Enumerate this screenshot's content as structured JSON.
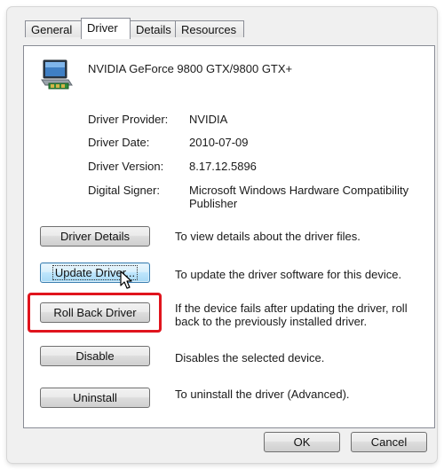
{
  "tabs": [
    {
      "label": "General"
    },
    {
      "label": "Driver"
    },
    {
      "label": "Details"
    },
    {
      "label": "Resources"
    }
  ],
  "device": {
    "name": "NVIDIA GeForce 9800 GTX/9800 GTX+",
    "icon": "display-adapter-icon"
  },
  "info": {
    "provider_label": "Driver Provider:",
    "provider_value": "NVIDIA",
    "date_label": "Driver Date:",
    "date_value": "2010-07-09",
    "version_label": "Driver Version:",
    "version_value": "8.17.12.5896",
    "signer_label": "Digital Signer:",
    "signer_value": "Microsoft Windows Hardware Compatibility Publisher"
  },
  "actions": {
    "driver_details": {
      "label": "Driver Details",
      "description": "To view details about the driver files."
    },
    "update_driver": {
      "label": "Update Driver...",
      "description": "To update the driver software for this device."
    },
    "roll_back": {
      "label": "Roll Back Driver",
      "description": "If the device fails after updating the driver, roll back to the previously installed driver."
    },
    "disable": {
      "label": "Disable",
      "description": "Disables the selected device."
    },
    "uninstall": {
      "label": "Uninstall",
      "description": "To uninstall the driver (Advanced)."
    }
  },
  "footer": {
    "ok_label": "OK",
    "cancel_label": "Cancel"
  },
  "colors": {
    "highlight": "#e0141d",
    "focus_button": "#bee6fd"
  }
}
